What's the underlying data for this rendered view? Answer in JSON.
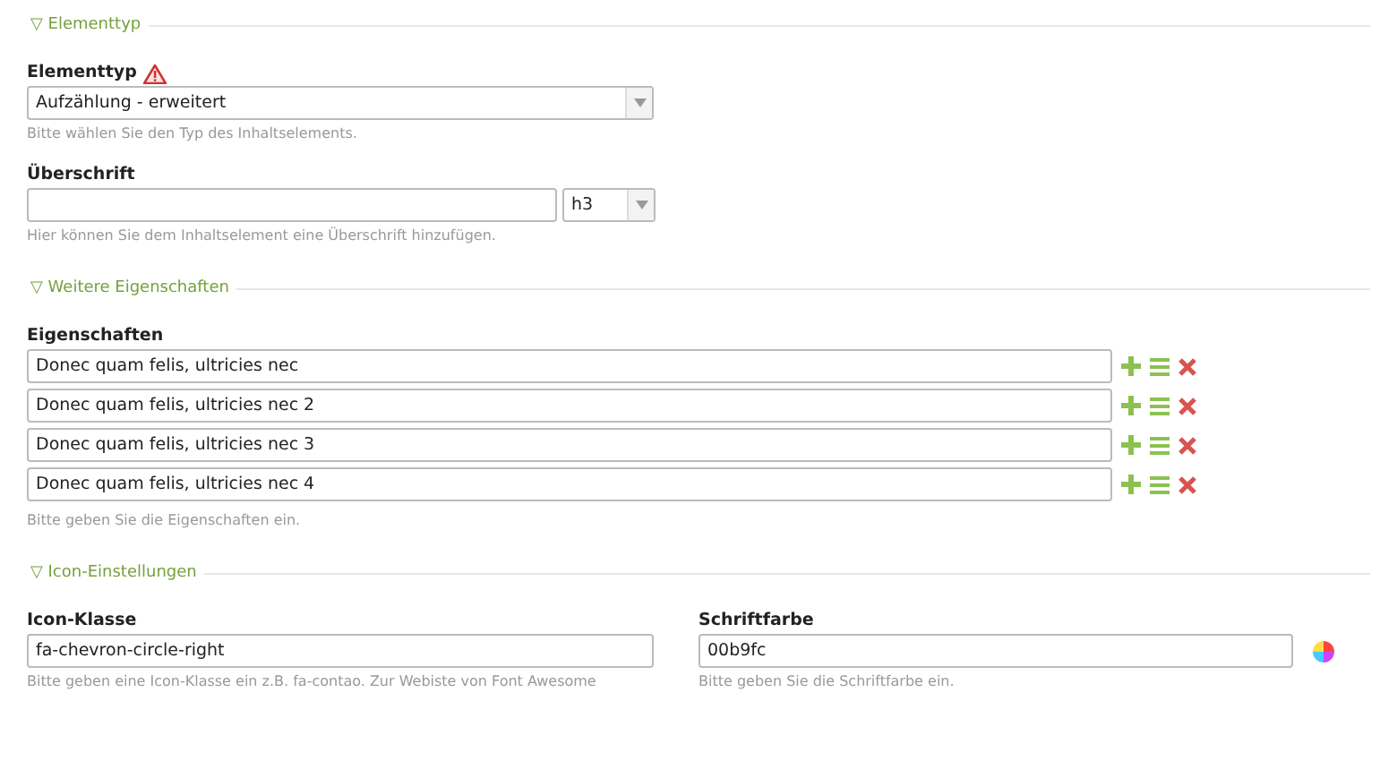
{
  "sections": [
    {
      "toggle": "▽",
      "title": "Elementtyp",
      "fields": [
        {
          "kind": "select",
          "label": "Elementtyp",
          "required_warning": true,
          "value": "Aufzählung - erweitert",
          "help": "Bitte wählen Sie den Typ des Inhaltselements."
        },
        {
          "kind": "text-select",
          "label": "Überschrift",
          "option": "h3",
          "help": "Hier können Sie dem Inhaltselement eine Überschrift hinzufügen."
        }
      ]
    },
    {
      "toggle": "▽",
      "title": "Weitere Eigenschaften",
      "fields": [
        {
          "kind": "list",
          "label": "Eigenschaften",
          "items": [
            "Donec quam felis, ultricies nec",
            "Donec quam felis, ultricies nec 2",
            "Donec quam felis, ultricies nec 3",
            "Donec quam felis, ultricies nec 4"
          ],
          "help": "Bitte geben Sie die Eigenschaften ein."
        }
      ]
    },
    {
      "toggle": "▽",
      "title": "Icon-Einstellungen",
      "fields": [
        {
          "kind": "text",
          "label": "Icon-Klasse",
          "value": "fa-chevron-circle-right",
          "help": "Bitte geben eine Icon-Klasse ein z.B. fa-contao. Zur Webiste von Font Awesome"
        },
        {
          "kind": "color",
          "label": "Schriftfarbe",
          "value": "00b9fc",
          "help": "Bitte geben Sie die Schriftfarbe ein."
        }
      ]
    }
  ]
}
